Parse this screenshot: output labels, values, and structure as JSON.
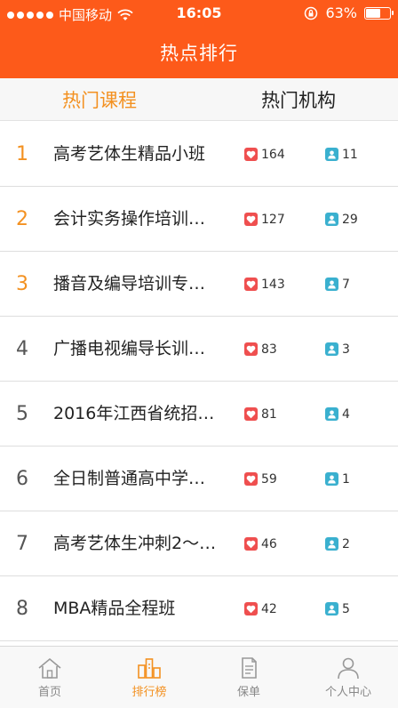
{
  "status_bar": {
    "carrier": "中国移动",
    "time": "16:05",
    "battery": "63%",
    "battery_level": 0.63
  },
  "header": {
    "title": "热点排行"
  },
  "tabs": [
    {
      "label": "热门课程",
      "active": true
    },
    {
      "label": "热门机构",
      "active": false
    }
  ],
  "list": [
    {
      "rank": "1",
      "title": "高考艺体生精品小班",
      "likes": "164",
      "users": "11"
    },
    {
      "rank": "2",
      "title": "会计实务操作培训…",
      "likes": "127",
      "users": "29"
    },
    {
      "rank": "3",
      "title": "播音及编导培训专…",
      "likes": "143",
      "users": "7"
    },
    {
      "rank": "4",
      "title": "广播电视编导长训…",
      "likes": "83",
      "users": "3"
    },
    {
      "rank": "5",
      "title": "2016年江西省统招…",
      "likes": "81",
      "users": "4"
    },
    {
      "rank": "6",
      "title": "全日制普通高中学…",
      "likes": "59",
      "users": "1"
    },
    {
      "rank": "7",
      "title": "高考艺体生冲刺2～…",
      "likes": "46",
      "users": "2"
    },
    {
      "rank": "8",
      "title": "MBA精品全程班",
      "likes": "42",
      "users": "5"
    }
  ],
  "tabbar": [
    {
      "label": "首页",
      "icon": "home-icon",
      "active": false
    },
    {
      "label": "排行榜",
      "icon": "ranking-icon",
      "active": true
    },
    {
      "label": "保单",
      "icon": "document-icon",
      "active": false
    },
    {
      "label": "个人中心",
      "icon": "profile-icon",
      "active": false
    }
  ],
  "colors": {
    "brand": "#fd5a1a",
    "accent": "#f39121",
    "heart": "#ef4f4f",
    "person": "#3ab0cf"
  }
}
